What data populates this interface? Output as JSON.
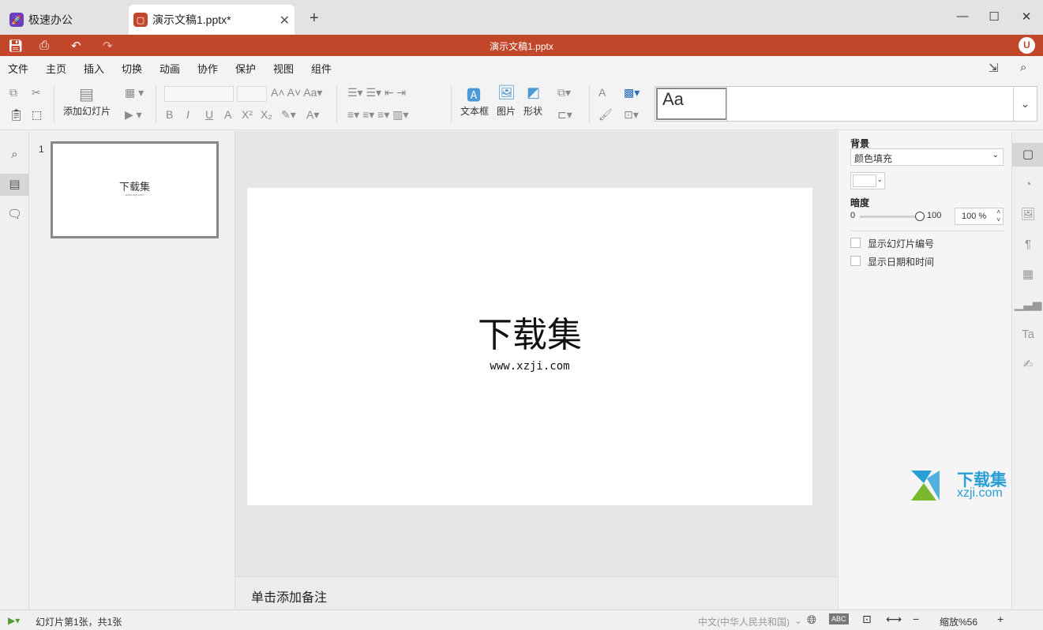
{
  "tabs": {
    "home_label": "极速办公",
    "doc_label": "演示文稿1.pptx*",
    "add": "+"
  },
  "window": {
    "minimize": "—",
    "maximize": "☐",
    "close": "✕"
  },
  "titlebar": {
    "title": "演示文稿1.pptx",
    "avatar": "U"
  },
  "menu": {
    "items": [
      "文件",
      "主页",
      "插入",
      "切换",
      "动画",
      "协作",
      "保护",
      "视图",
      "组件"
    ],
    "active": "主页"
  },
  "ribbon": {
    "add_slide": "添加幻灯片",
    "textbox": "文本框",
    "image": "图片",
    "shape": "形状",
    "theme_sample": "Aa"
  },
  "thumbnails": [
    {
      "index": "1",
      "title": "下载集",
      "sub": "www.xzji.com"
    }
  ],
  "slide": {
    "title": "下载集",
    "subtitle": "www.xzji.com"
  },
  "notes": {
    "placeholder": "单击添加备注"
  },
  "right_panel": {
    "background_label": "背景",
    "fill_select": "颜色填充",
    "opacity_label": "暗度",
    "opacity_min": "0",
    "opacity_max": "100",
    "opacity_value": "100 %",
    "show_slide_number": "显示幻灯片编号",
    "show_date_time": "显示日期和时间"
  },
  "status": {
    "slide_info": "幻灯片第1张，共1张",
    "language": "中文(中华人民共和国)",
    "zoom_label": "缩放%56"
  },
  "watermark": {
    "text": "下载集",
    "url": "xzji.com"
  },
  "colors": {
    "accent": "#c2472a",
    "tab_logo_home": "#6a3fc2",
    "tab_logo_doc": "#c2472a"
  }
}
